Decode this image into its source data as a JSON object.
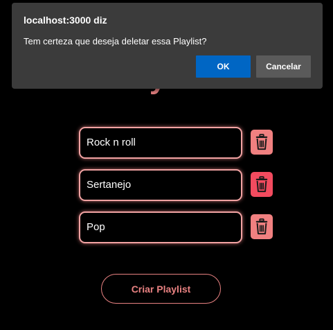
{
  "dialog": {
    "title": "localhost:3000 diz",
    "message": "Tem certeza que deseja deletar essa Playlist?",
    "ok_label": "OK",
    "cancel_label": "Cancelar"
  },
  "page": {
    "title": "Playlists"
  },
  "playlists": [
    {
      "name": "Rock n roll",
      "delete_icon": "trash-icon"
    },
    {
      "name": "Sertanejo",
      "delete_icon": "trash-icon"
    },
    {
      "name": "Pop",
      "delete_icon": "trash-icon"
    }
  ],
  "actions": {
    "create_label": "Criar Playlist"
  },
  "colors": {
    "background": "#000000",
    "accent": "#e98282",
    "delete_button": "#f08080",
    "delete_button_active": "#f24b5f",
    "dialog_background": "#3b3b3b",
    "dialog_ok": "#0066c4",
    "dialog_cancel": "#5a5a5a"
  }
}
